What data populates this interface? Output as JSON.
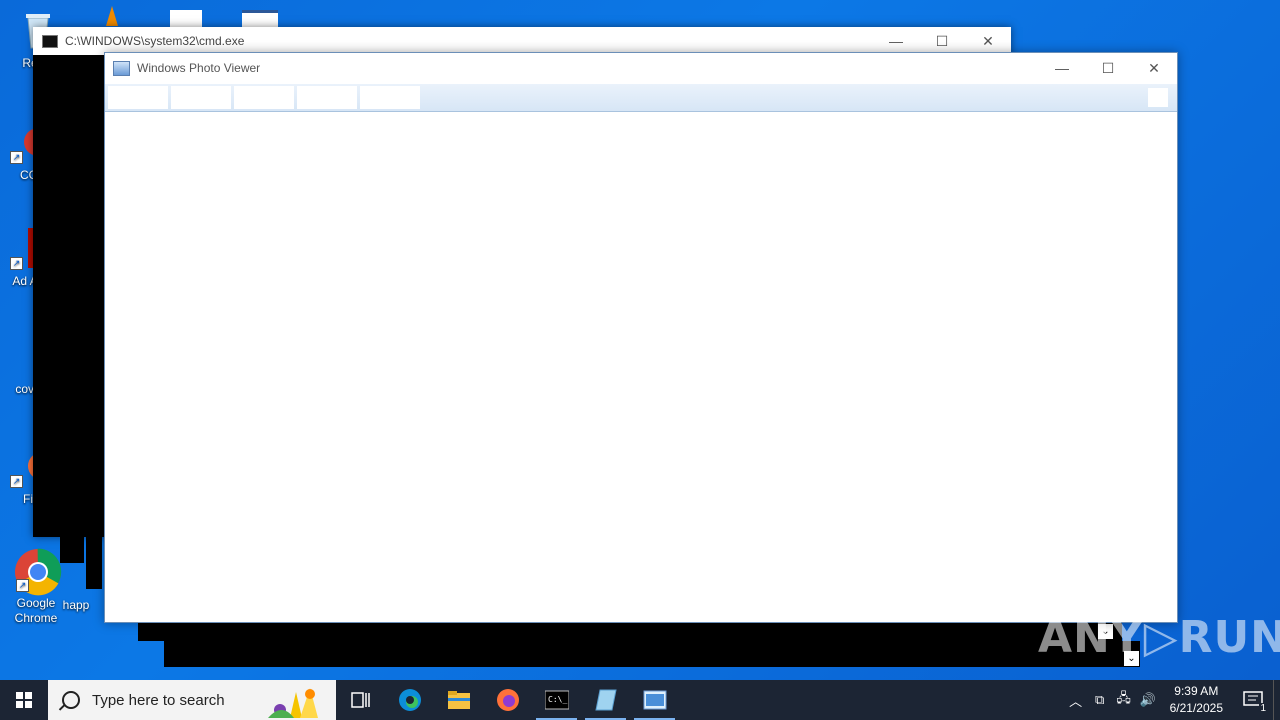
{
  "desktop": {
    "icons": [
      {
        "label": "Recy"
      },
      {
        "label": "CCl"
      },
      {
        "label": "Ad Acr"
      },
      {
        "label": "cover"
      },
      {
        "label": "Fir"
      },
      {
        "label": "Google Chrome"
      },
      {
        "label": "happ"
      }
    ]
  },
  "cmd_window": {
    "title": "C:\\WINDOWS\\system32\\cmd.exe",
    "minimize": "—",
    "maximize": "☐",
    "close": "✕"
  },
  "photo_viewer": {
    "title": "Windows Photo Viewer",
    "minimize": "—",
    "maximize": "☐",
    "close": "✕"
  },
  "watermark": "ANY▷RUN",
  "taskbar": {
    "search_placeholder": "Type here to search",
    "clock_time": "9:39 AM",
    "clock_date": "6/21/2025",
    "notification_count": "1",
    "apps": [
      "task-view",
      "edge",
      "file-explorer",
      "firefox",
      "cmd",
      "notepad",
      "photo-viewer"
    ]
  },
  "colors": {
    "desktop_bg": "#0c78e6",
    "taskbar_bg": "#1c2534",
    "active_indicator": "#7bb3f0"
  }
}
